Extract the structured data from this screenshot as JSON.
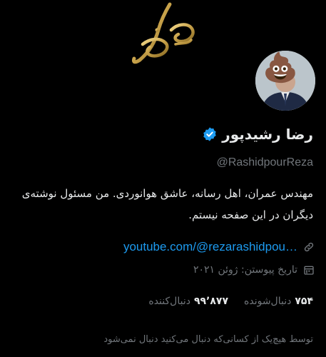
{
  "profile": {
    "display_name": "رضا رشیدپور",
    "handle": "@RashidpourReza",
    "bio": "مهندس عمران، اهل رسانه، عاشق هوانوردی. من مسئول نوشته‌ی دیگران در این صفحه نیستم.",
    "link_text": "youtube.com/@rezarashidpou…",
    "joined": "تاریخ پیوستن: ژوئن ۲۰۲۱",
    "following_count": "۷۵۴",
    "following_label": "دنبال‌شونده",
    "followers_count": "۹۹٬۸۷۷",
    "followers_label": "دنبال‌کننده",
    "followed_by_note": "توسط هیچ‌یک از کسانی‌که دنبال می‌کنید دنبال نمی‌شود",
    "avatar_emoji": "💩"
  },
  "icons": {
    "verified": "verified-badge-icon",
    "link": "link-icon",
    "calendar": "calendar-icon"
  },
  "colors": {
    "accent": "#1d9bf0",
    "banner_gold": "#c8a24a",
    "background": "#000000",
    "muted": "#71767b"
  }
}
